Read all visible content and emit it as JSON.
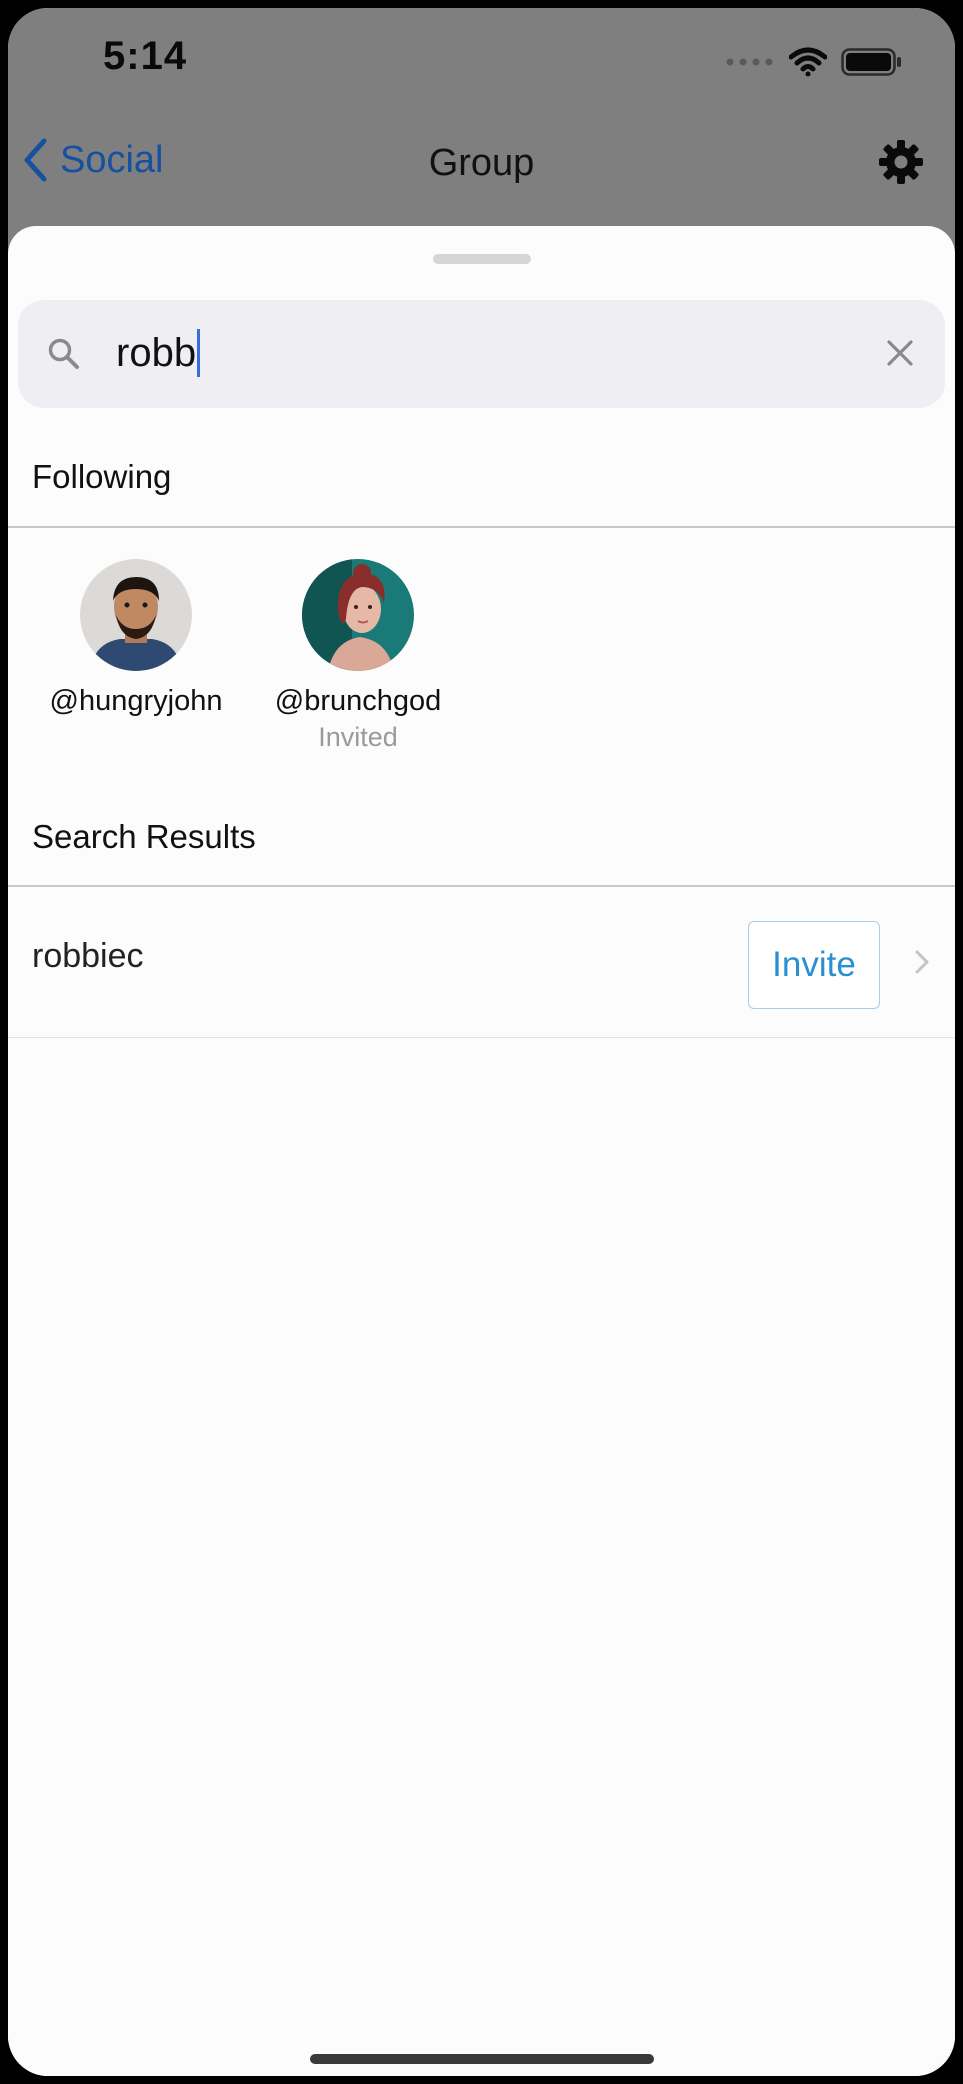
{
  "status_bar": {
    "time": "5:14",
    "icons": [
      "signal-dots-icon",
      "wifi-icon",
      "battery-icon"
    ]
  },
  "nav": {
    "back_label": "Social",
    "title": "Group",
    "settings_icon": "gear-icon"
  },
  "search": {
    "value": "robb",
    "icon": "search-icon",
    "clear_icon": "close-icon"
  },
  "following": {
    "header": "Following",
    "people": [
      {
        "handle": "@hungryjohn",
        "status": ""
      },
      {
        "handle": "@brunchgod",
        "status": "Invited"
      }
    ]
  },
  "results": {
    "header": "Search Results",
    "rows": [
      {
        "name": "robbiec",
        "action_label": "Invite"
      }
    ]
  },
  "colors": {
    "accent_blue": "#2a8fd0",
    "back_blue": "#1551a0",
    "backdrop_gray": "#7f7f7f"
  }
}
